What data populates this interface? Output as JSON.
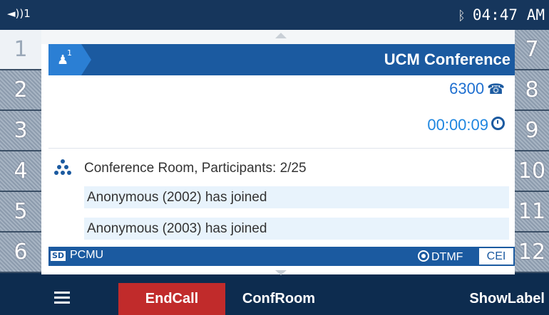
{
  "status_bar": {
    "volume_text": "◄))1",
    "bluetooth_icon": "bluetooth-icon",
    "time": "04:47 AM"
  },
  "line_keys_left": [
    "1",
    "2",
    "3",
    "4",
    "5",
    "6"
  ],
  "line_keys_right": [
    "7",
    "8",
    "9",
    "10",
    "11",
    "12"
  ],
  "call": {
    "participant_count_badge": "1",
    "title": "UCM Conference",
    "number": "6300",
    "duration": "00:00:09",
    "conference_info": "Conference Room, Participants: 2/25",
    "events": [
      "Anonymous (2002) has joined",
      "Anonymous (2003) has joined"
    ],
    "hd_badge": "SD",
    "codec": "PCMU",
    "dtmf_label": "DTMF",
    "cei_label": "CEI"
  },
  "softkeys": {
    "endcall": "EndCall",
    "confroom": "ConfRoom",
    "showlabel": "ShowLabel"
  },
  "colors": {
    "accent": "#1b5aa0",
    "endcall": "#c12b2b",
    "event_bg": "#e8f3fc"
  }
}
